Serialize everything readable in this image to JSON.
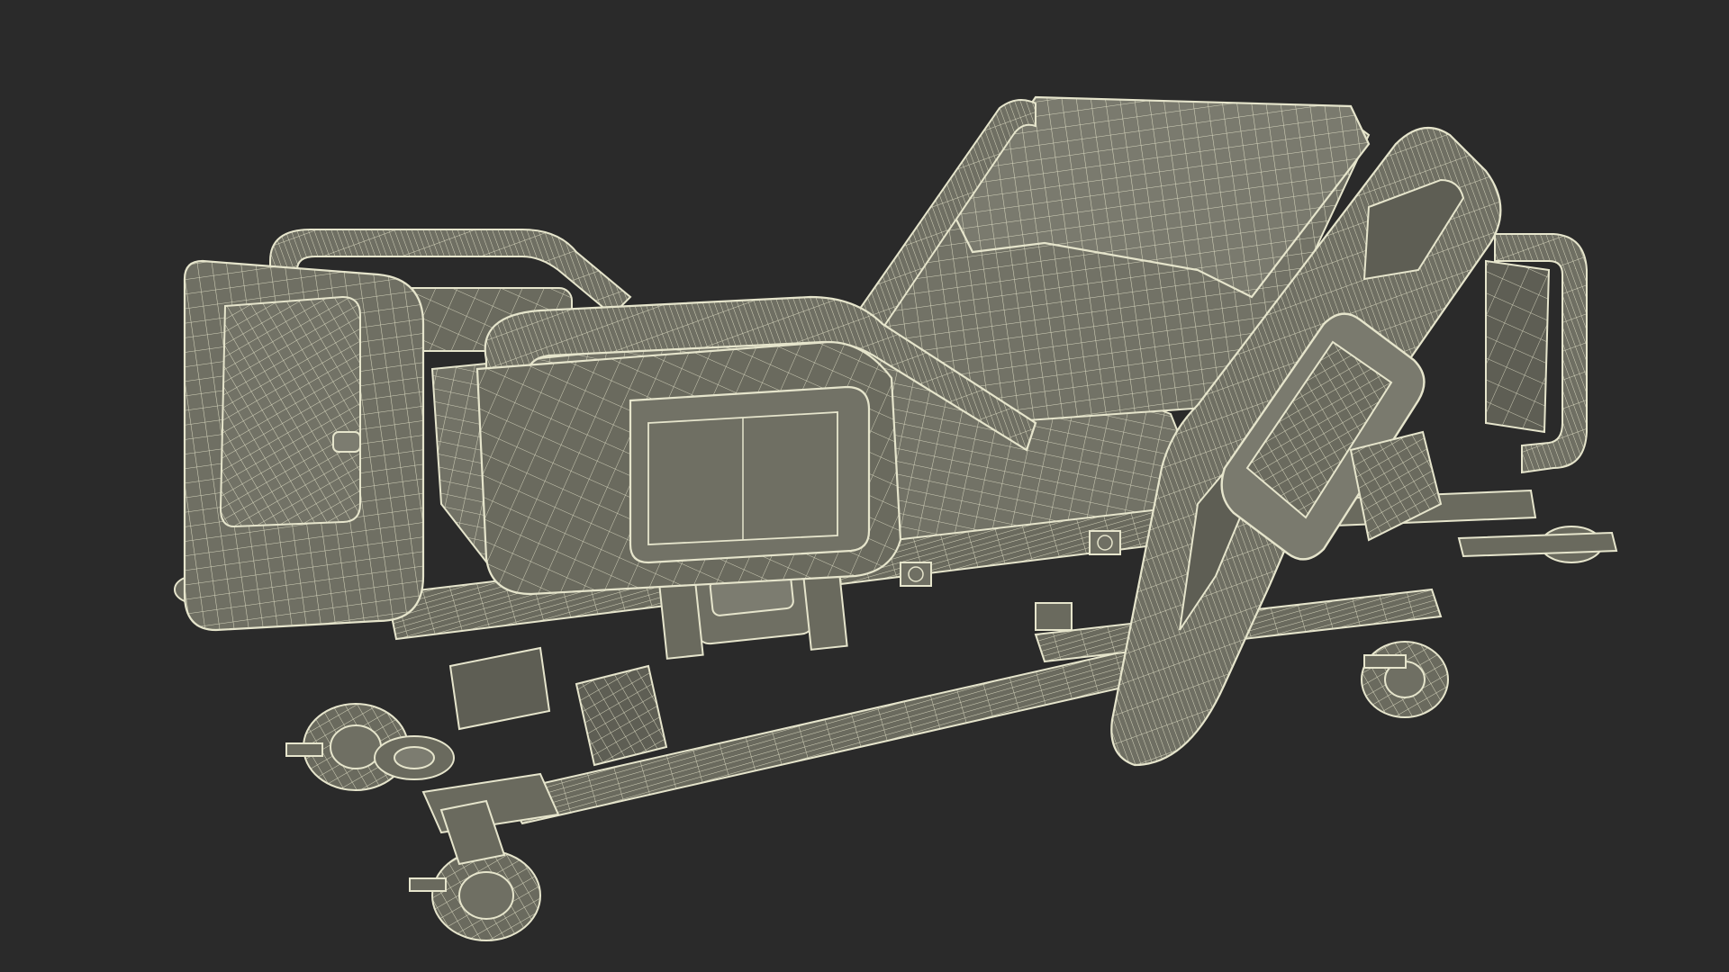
{
  "scene": {
    "background_color": "#2a2a2a",
    "model_fill": "#6f6f63",
    "model_fill_light": "#7c7c70",
    "model_fill_dark": "#5e5e54",
    "wire_color": "#e6e5cc",
    "subject": "hospital-bed-wireframe"
  }
}
